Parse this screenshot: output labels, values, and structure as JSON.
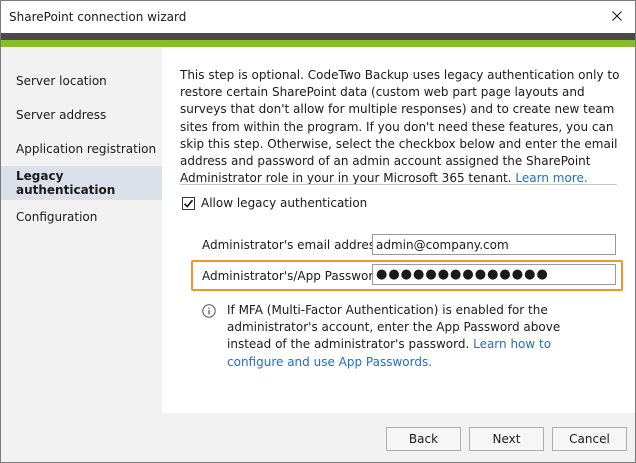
{
  "window": {
    "title": "SharePoint connection wizard"
  },
  "sidebar": {
    "items": [
      {
        "label": "Server location",
        "active": false
      },
      {
        "label": "Server address",
        "active": false
      },
      {
        "label": "Application registration",
        "active": false
      },
      {
        "label": "Legacy authentication",
        "active": true
      },
      {
        "label": "Configuration",
        "active": false
      }
    ]
  },
  "main": {
    "description": "This step is optional. CodeTwo Backup uses legacy authentication only to restore certain SharePoint data (custom web part page layouts and surveys that don't allow for multiple responses) and to create new team sites from within the program. If you don't need these features, you can skip this step. Otherwise, select the checkbox below and enter the email address and password of an admin account assigned the SharePoint Administrator role in your in your Microsoft 365 tenant.",
    "learn_more": "Learn more.",
    "allow_legacy_label": "Allow legacy authentication",
    "allow_legacy_checked": true,
    "email_label": "Administrator's email address:",
    "email_value": "admin@company.com",
    "password_label": "Administrator's/App Password:",
    "password_value": "●●●●●●●●●●●●●●",
    "info_text": "If MFA (Multi-Factor Authentication) is enabled for the administrator's account, enter the App Password above instead of the administrator's password.",
    "info_link": "Learn how to configure and use App Passwords."
  },
  "footer": {
    "back_label": "Back",
    "next_label": "Next",
    "cancel_label": "Cancel"
  },
  "colors": {
    "accent_green": "#86bd2b",
    "band_dark": "#4a4a4a",
    "highlight_orange": "#f0962d",
    "link_blue": "#1f6fc4",
    "active_nav": "#dbe0ea"
  },
  "icons": {
    "close": "close-icon",
    "check": "checkmark-icon",
    "info": "info-icon"
  }
}
